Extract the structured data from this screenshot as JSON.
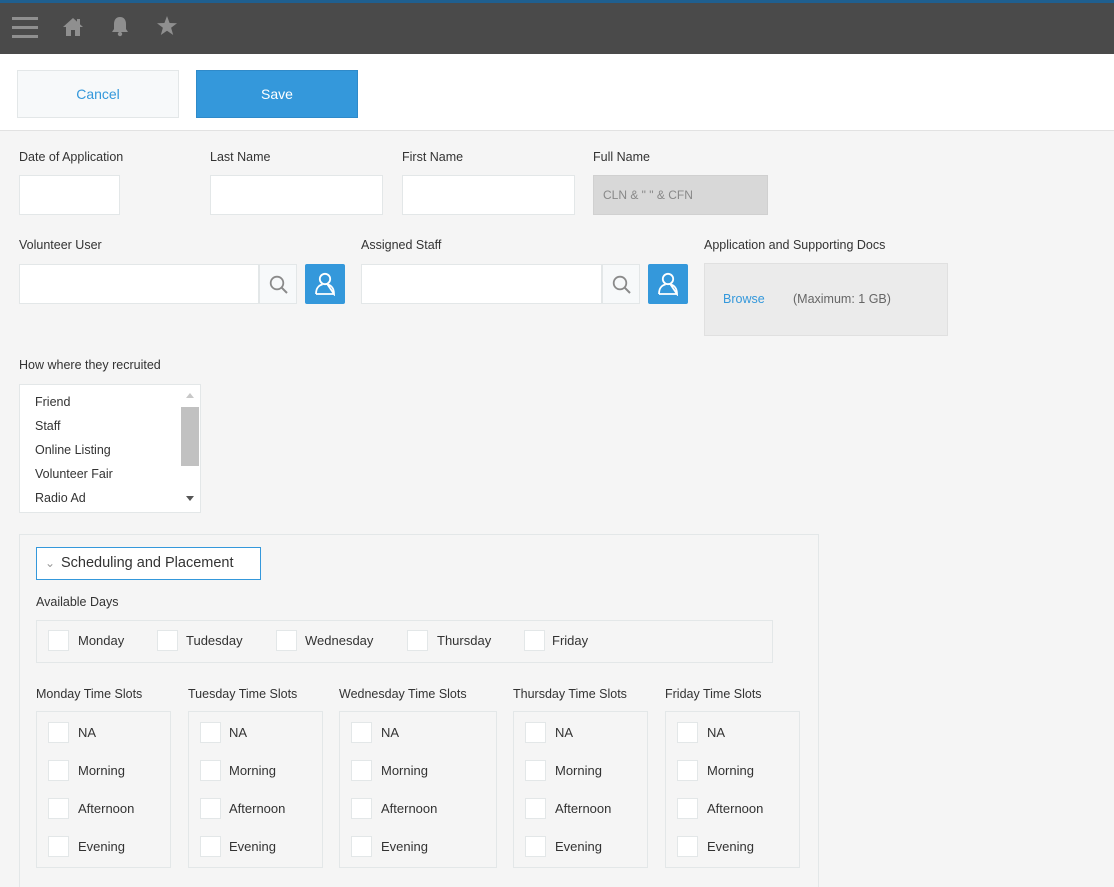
{
  "toolbar": {
    "cancel_label": "Cancel",
    "save_label": "Save"
  },
  "fields": {
    "date_of_application": {
      "label": "Date of Application",
      "value": ""
    },
    "last_name": {
      "label": "Last Name",
      "value": ""
    },
    "first_name": {
      "label": "First Name",
      "value": ""
    },
    "full_name": {
      "label": "Full Name",
      "value": "CLN & \" \" & CFN"
    },
    "volunteer_user": {
      "label": "Volunteer User",
      "value": ""
    },
    "assigned_staff": {
      "label": "Assigned Staff",
      "value": ""
    },
    "attachments": {
      "label": "Application and Supporting Docs",
      "browse_label": "Browse",
      "max_size": "(Maximum: 1 GB)"
    },
    "recruited": {
      "label": "How where they recruited",
      "options": [
        "Friend",
        "Staff",
        "Online Listing",
        "Volunteer Fair",
        "Radio Ad"
      ]
    }
  },
  "scheduling": {
    "title": "Scheduling and Placement",
    "available_days_label": "Available Days",
    "days": [
      "Monday",
      "Tudesday",
      "Wednesday",
      "Thursday",
      "Friday"
    ],
    "slot_groups": [
      {
        "label": "Monday Time Slots",
        "options": [
          "NA",
          "Morning",
          "Afternoon",
          "Evening"
        ]
      },
      {
        "label": "Tuesday Time Slots",
        "options": [
          "NA",
          "Morning",
          "Afternoon",
          "Evening"
        ]
      },
      {
        "label": "Wednesday Time Slots",
        "options": [
          "NA",
          "Morning",
          "Afternoon",
          "Evening"
        ]
      },
      {
        "label": "Thursday Time Slots",
        "options": [
          "NA",
          "Morning",
          "Afternoon",
          "Evening"
        ]
      },
      {
        "label": "Friday Time Slots",
        "options": [
          "NA",
          "Morning",
          "Afternoon",
          "Evening"
        ]
      }
    ]
  },
  "icons": {
    "menu": "menu-icon",
    "home": "home-icon",
    "notifications": "bell-icon",
    "favorites": "star-icon",
    "search": "search-icon",
    "user": "user-icon"
  },
  "colors": {
    "accent": "#3498db",
    "topbar": "#4a4a4a",
    "topbar_stripe": "#1f5f8f"
  }
}
